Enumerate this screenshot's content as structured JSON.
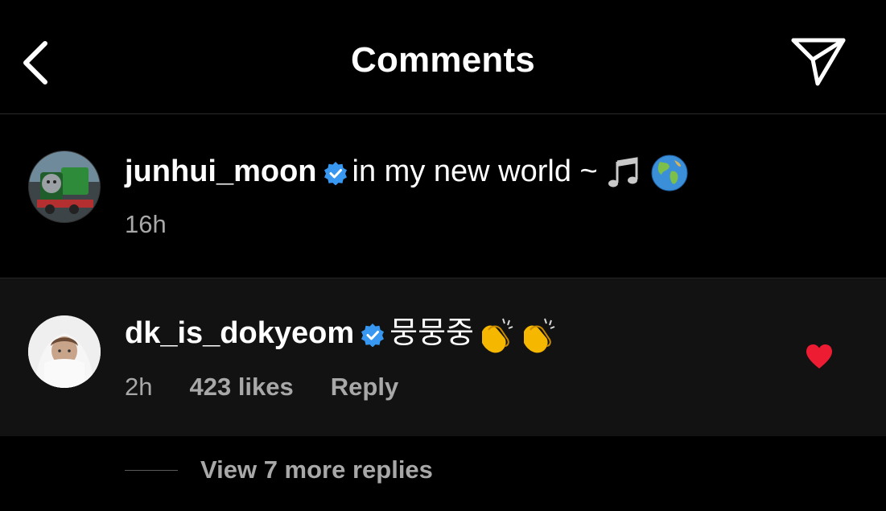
{
  "header": {
    "title": "Comments",
    "back_icon": "chevron-left-icon",
    "share_icon": "paper-plane-icon"
  },
  "caption": {
    "username": "junhui_moon",
    "verified": true,
    "text": "in my new world ~",
    "emojis": [
      "musical-notes-emoji",
      "globe-emoji"
    ],
    "time": "16h"
  },
  "comment": {
    "username": "dk_is_dokyeom",
    "verified": true,
    "text": "뭉뭉중",
    "emojis": [
      "clapping-hands-emoji",
      "clapping-hands-emoji"
    ],
    "time": "2h",
    "likes": "423 likes",
    "reply_label": "Reply",
    "liked": true
  },
  "replies": {
    "label": "View 7 more replies"
  },
  "colors": {
    "background": "#000000",
    "comment_background": "#121212",
    "verified_blue": "#3897f0",
    "like_red": "#ed1c33",
    "secondary_text": "#a8a8a8"
  }
}
